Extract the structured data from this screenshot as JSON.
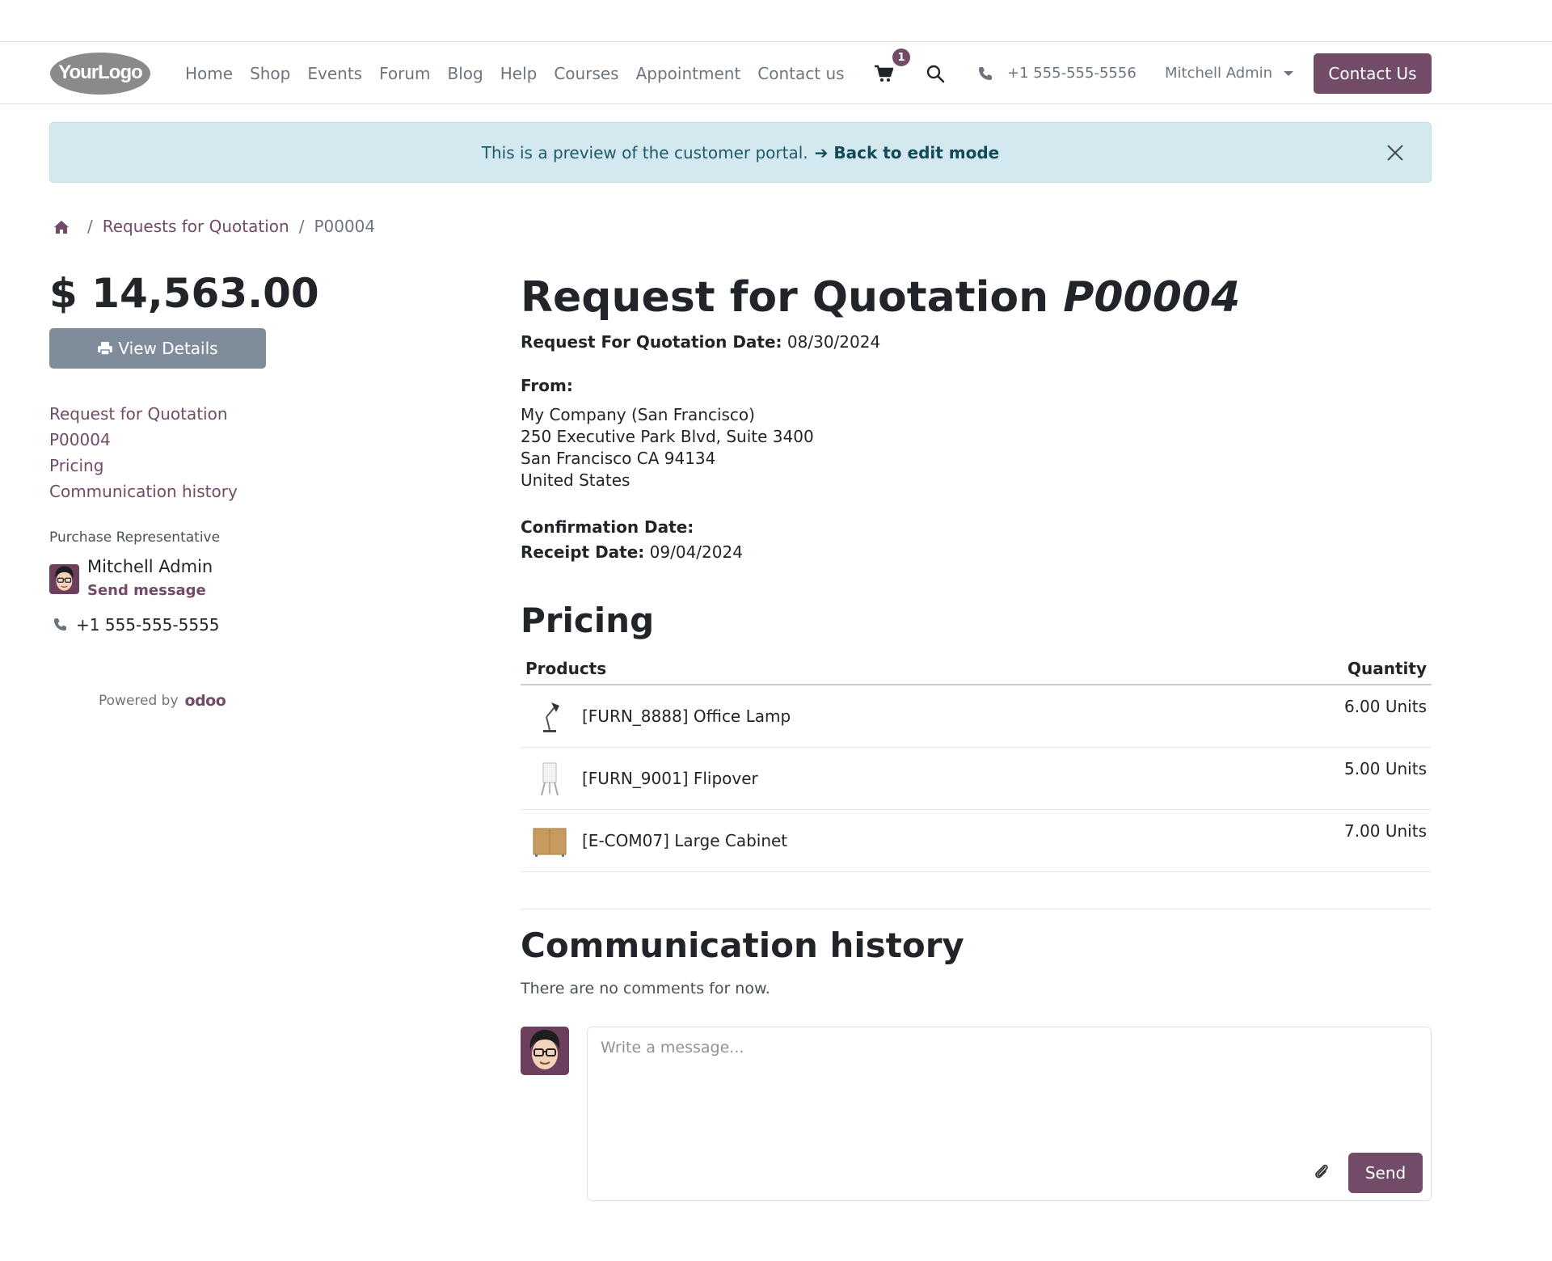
{
  "header": {
    "logo_text": "YourLogo",
    "nav": [
      "Home",
      "Shop",
      "Events",
      "Forum",
      "Blog",
      "Help",
      "Courses",
      "Appointment",
      "Contact us"
    ],
    "cart_count": "1",
    "phone": "+1 555-555-5556",
    "user": "Mitchell Admin",
    "contact_button": "Contact Us"
  },
  "alert": {
    "text": "This is a preview of the customer portal.",
    "back_link": "Back to edit mode"
  },
  "breadcrumb": {
    "items": [
      "Requests for Quotation",
      "P00004"
    ]
  },
  "sidebar": {
    "amount": "$ 14,563.00",
    "view_details": "View Details",
    "toc": [
      "Request for Quotation",
      "P00004",
      "Pricing",
      "Communication history"
    ],
    "rep_label": "Purchase Representative",
    "rep_name": "Mitchell Admin",
    "send_message": "Send message",
    "rep_phone": "+1 555-555-5555",
    "powered_by": "Powered by",
    "odoo": "odoo"
  },
  "main": {
    "title_prefix": "Request for Quotation",
    "title_ref": "P00004",
    "rfq_date_label": "Request For Quotation Date:",
    "rfq_date": "08/30/2024",
    "from_label": "From:",
    "address": [
      "My Company (San Francisco)",
      "250 Executive Park Blvd, Suite 3400",
      "San Francisco CA 94134",
      "United States"
    ],
    "confirmation_label": "Confirmation Date:",
    "receipt_label": "Receipt Date:",
    "receipt_date": "09/04/2024",
    "pricing_heading": "Pricing",
    "table": {
      "headers": [
        "Products",
        "Quantity"
      ],
      "rows": [
        {
          "name": "[FURN_8888] Office Lamp",
          "qty": "6.00 Units",
          "icon": "lamp-icon"
        },
        {
          "name": "[FURN_9001] Flipover",
          "qty": "5.00 Units",
          "icon": "flipover-icon"
        },
        {
          "name": "[E-COM07] Large Cabinet",
          "qty": "7.00 Units",
          "icon": "cabinet-icon"
        }
      ]
    },
    "comm_heading": "Communication history",
    "no_comments": "There are no comments for now.",
    "composer_placeholder": "Write a message...",
    "send_button": "Send"
  },
  "colors": {
    "brand": "#714b67",
    "alert_bg": "#d3e9ef",
    "view_btn": "#7f8d9b"
  }
}
